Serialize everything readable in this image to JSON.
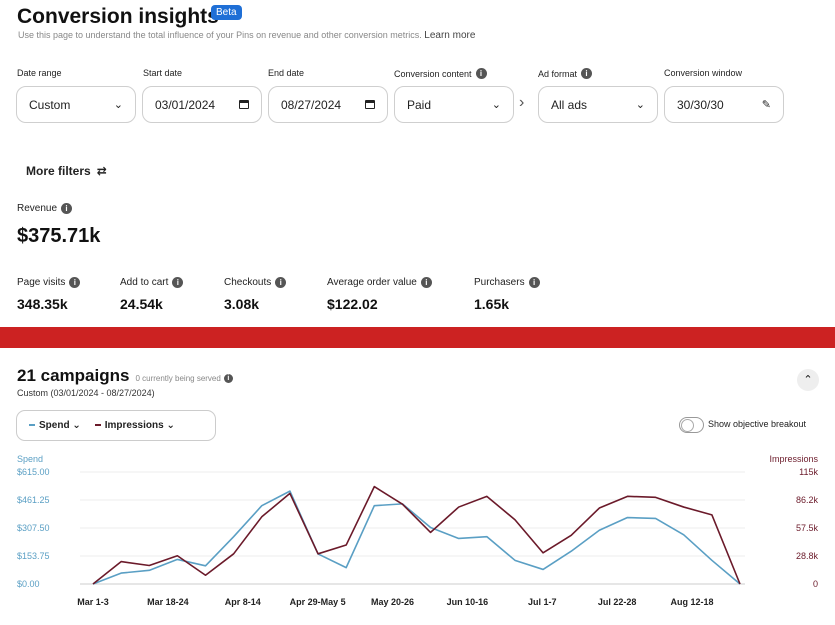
{
  "header": {
    "title": "Conversion insights",
    "badge": "Beta",
    "subtitle": "Use this page to understand the total influence of your Pins on revenue and other conversion metrics.",
    "learn_more": "Learn more"
  },
  "filters": {
    "date_range": {
      "label": "Date range",
      "value": "Custom"
    },
    "start_date": {
      "label": "Start date",
      "value": "03/01/2024"
    },
    "end_date": {
      "label": "End date",
      "value": "08/27/2024"
    },
    "conversion_content": {
      "label": "Conversion content",
      "value": "Paid"
    },
    "ad_format": {
      "label": "Ad format",
      "value": "All ads"
    },
    "conversion_window": {
      "label": "Conversion window",
      "value": "30/30/30"
    },
    "more_filters": "More filters"
  },
  "revenue": {
    "label": "Revenue",
    "value": "$375.71k"
  },
  "metrics": [
    {
      "label": "Page visits",
      "value": "348.35k"
    },
    {
      "label": "Add to cart",
      "value": "24.54k"
    },
    {
      "label": "Checkouts",
      "value": "3.08k"
    },
    {
      "label": "Average order value",
      "value": "$122.02"
    },
    {
      "label": "Purchasers",
      "value": "1.65k"
    }
  ],
  "campaigns": {
    "title": "21 campaigns",
    "served": "0 currently being served",
    "range": "Custom (03/01/2024 - 08/27/2024)",
    "spend_label": "Spend",
    "impressions_label": "Impressions",
    "objective_toggle_label": "Show objective breakout"
  },
  "colors": {
    "spend": "#5a9fc4",
    "impressions": "#6b1a2a",
    "banner": "#cc2222",
    "badge": "#1f6fd6"
  },
  "chart_data": {
    "type": "line",
    "left_axis_title": "Spend",
    "right_axis_title": "Impressions",
    "left_ticks": [
      "$615.00",
      "$461.25",
      "$307.50",
      "$153.75",
      "$0.00"
    ],
    "right_ticks": [
      "115k",
      "86.2k",
      "57.5k",
      "28.8k",
      "0"
    ],
    "x_labels": [
      "Mar 1-3",
      "Mar 18-24",
      "Apr 8-14",
      "Apr 29-May 5",
      "May 20-26",
      "Jun 10-16",
      "Jul 1-7",
      "Jul 22-28",
      "Aug 12-18"
    ],
    "ylim_spend": [
      0,
      615
    ],
    "ylim_impressions": [
      0,
      115000
    ],
    "series": [
      {
        "name": "Spend",
        "axis": "left",
        "values": [
          0,
          60,
          75,
          135,
          100,
          260,
          430,
          510,
          165,
          90,
          430,
          440,
          310,
          250,
          260,
          130,
          80,
          180,
          295,
          365,
          360,
          270,
          130,
          0
        ]
      },
      {
        "name": "Impressions",
        "axis": "right",
        "values": [
          0,
          23000,
          19000,
          29000,
          9000,
          31000,
          69000,
          93000,
          31000,
          40000,
          100000,
          82000,
          53000,
          79000,
          90000,
          66000,
          32000,
          50000,
          78000,
          90000,
          89000,
          79000,
          71000,
          0
        ]
      }
    ]
  }
}
